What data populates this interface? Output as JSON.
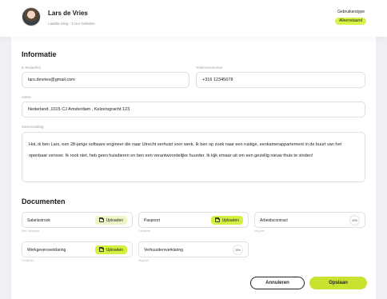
{
  "header": {
    "user_name": "Lars de Vries",
    "last_login": "Laatste inlog : 3 Uur Geleden",
    "usertype_label": "Gebruikerstype",
    "usertype_value": "Alleenstaand"
  },
  "info": {
    "title": "Informatie",
    "email_label": "E-Mailadres",
    "email_value": "lars.devries@gmail.com",
    "phone_label": "Telefoonnummer",
    "phone_value": "+316 12345678",
    "address_label": "Adres",
    "address_value": "Nederland ,1015 CJ Amsterdam , Keizersgracht 123",
    "summary_label": "Samenvatting",
    "summary_value": "Hoi, ik ben Lars, een 28-jarige software engineer die naar Utrecht verhuist voor werk. Ik ben op zoek naar een rustige, eenkamerappartement in de buurt van het openbaar vervoer. Ik rook niet, heb geen huisdieren en ben een verantwoordelijke huurder. Ik kijk ernaar uit om een gezellig nieuw thuis te vinden!"
  },
  "documents": {
    "title": "Documenten",
    "items": [
      {
        "name": "Salarisstrook",
        "action": "Uploaden",
        "sub": "Niet Geüpload"
      },
      {
        "name": "Paspoort",
        "action": "Uploaden",
        "sub": "Geüpload"
      },
      {
        "name": "Arbeidscontract",
        "progress": "10%",
        "sub": "Nog niet"
      },
      {
        "name": "Werkgeversverklaring",
        "action": "Uploaden",
        "sub": "Geüpload"
      },
      {
        "name": "Verhuurdersverklaring",
        "progress": "10%",
        "sub": "Nog niet"
      }
    ]
  },
  "actions": {
    "cancel_label": "Annuleren",
    "save_label": "Opslaan"
  },
  "colors": {
    "accent": "#c9e230",
    "badge": "#d9f24a",
    "upload_light": "#eef6c8",
    "upload_strong": "#d4ef3f"
  },
  "icons": {
    "upload": "folder-icon"
  }
}
